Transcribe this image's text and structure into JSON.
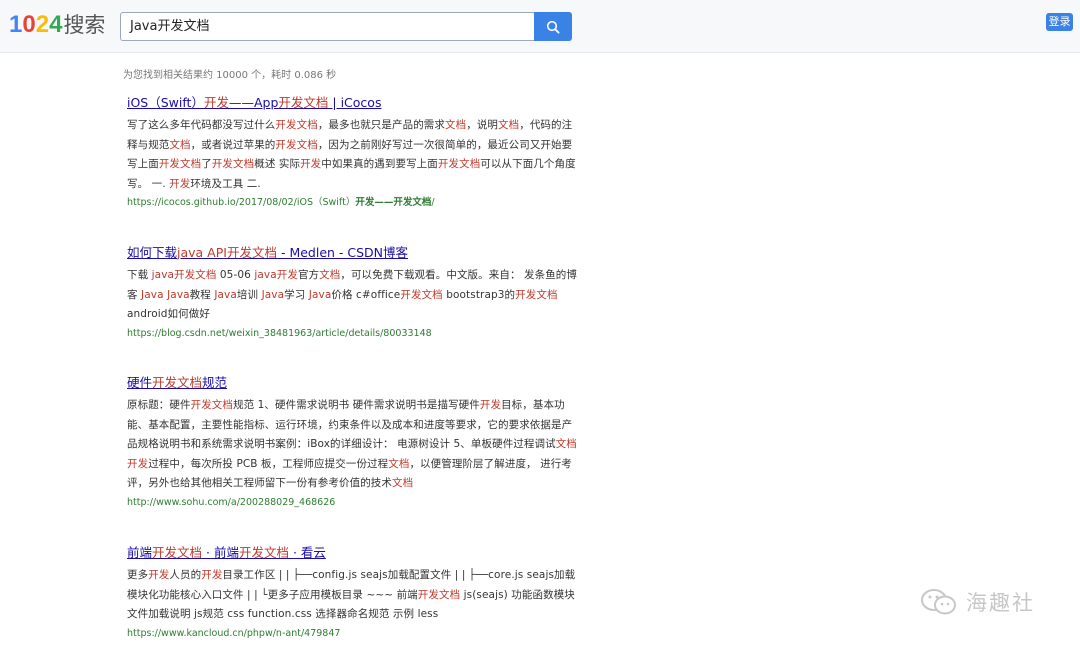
{
  "header": {
    "logo_digits": [
      "1",
      "0",
      "2",
      "4"
    ],
    "logo_text": "搜索",
    "search_value": "Java开发文档",
    "login_label": "登录"
  },
  "stats": "为您找到相关结果约 10000 个，耗时 0.086 秒",
  "results": [
    {
      "title": [
        [
          "iOS（Swift）",
          0
        ],
        [
          "开发",
          1
        ],
        [
          "——App",
          0
        ],
        [
          "开发文档",
          1
        ],
        [
          " | iCocos",
          0
        ]
      ],
      "snippet": [
        [
          "写了这么多年代码都没写过什么",
          0
        ],
        [
          "开发文档",
          1
        ],
        [
          "，最多也就只是产品的需求",
          0
        ],
        [
          "文档",
          1
        ],
        [
          "，说明",
          0
        ],
        [
          "文档",
          1
        ],
        [
          "，代码的注释与规范",
          0
        ],
        [
          "文档",
          1
        ],
        [
          "，或者说过苹果的",
          0
        ],
        [
          "开发文档",
          1
        ],
        [
          "，因为之前刚好写过一次很简单的，最近公司又开始要写上面",
          0
        ],
        [
          "开发文档",
          1
        ],
        [
          "了",
          0
        ],
        [
          "开发文档",
          1
        ],
        [
          "概述 实际",
          0
        ],
        [
          "开发",
          1
        ],
        [
          "中如果真的遇到要写上面",
          0
        ],
        [
          "开发文档",
          1
        ],
        [
          "可以从下面几个角度写。 一. ",
          0
        ],
        [
          "开发",
          1
        ],
        [
          "环境及工具 二.",
          0
        ]
      ],
      "url": [
        [
          "https://icocos.github.io/2017/08/02/iOS（Swift）",
          0
        ],
        [
          "开发——开发文档",
          1
        ],
        [
          "/",
          0
        ]
      ]
    },
    {
      "title": [
        [
          "如何下载",
          0
        ],
        [
          "java API",
          1
        ],
        [
          "开发文档",
          1
        ],
        [
          " - Medlen - CSDN博客",
          0
        ]
      ],
      "snippet": [
        [
          "下载 ",
          0
        ],
        [
          "java开发文档",
          1
        ],
        [
          " 05-06 ",
          0
        ],
        [
          "java开发",
          1
        ],
        [
          "官方",
          0
        ],
        [
          "文档",
          1
        ],
        [
          "，可以免费下载观看。中文版。来自： 发条鱼的博客 ",
          0
        ],
        [
          "Java",
          1
        ],
        [
          " ",
          0
        ],
        [
          "Java",
          1
        ],
        [
          "教程 ",
          0
        ],
        [
          "Java",
          1
        ],
        [
          "培训 ",
          0
        ],
        [
          "Java",
          1
        ],
        [
          "学习 ",
          0
        ],
        [
          "Java",
          1
        ],
        [
          "价格 c#office",
          0
        ],
        [
          "开发文档",
          1
        ],
        [
          " bootstrap3的",
          0
        ],
        [
          "开发文档",
          1
        ],
        [
          " android如何做好",
          0
        ]
      ],
      "url": [
        [
          "https://blog.csdn.net/weixin_38481963/article/details/80033148",
          0
        ]
      ]
    },
    {
      "title": [
        [
          "硬件",
          0
        ],
        [
          "开发文档",
          1
        ],
        [
          "规范",
          0
        ]
      ],
      "snippet": [
        [
          "原标题：硬件",
          0
        ],
        [
          "开发文档",
          1
        ],
        [
          "规范 1、硬件需求说明书 硬件需求说明书是描写硬件",
          0
        ],
        [
          "开发",
          1
        ],
        [
          "目标，基本功能、基本配置，主要性能指标、运行环境，约束条件以及成本和进度等要求，它的要求依据是产品规格说明书和系统需求说明书案例：iBox的详细设计： 电源树设计 5、单板硬件过程调试",
          0
        ],
        [
          "文档",
          1
        ],
        [
          " ",
          0
        ],
        [
          "开发",
          1
        ],
        [
          "过程中，每次所投 PCB 板，工程师应提交一份过程",
          0
        ],
        [
          "文档",
          1
        ],
        [
          "，以便管理阶层了解进度， 进行考评，另外也给其他相关工程师留下一份有参考价值的技术",
          0
        ],
        [
          "文档",
          1
        ]
      ],
      "url": [
        [
          "http://www.sohu.com/a/200288029_468626",
          0
        ]
      ]
    },
    {
      "title": [
        [
          "前端",
          0
        ],
        [
          "开发文档",
          1
        ],
        [
          " · 前端",
          0
        ],
        [
          "开发文档",
          1
        ],
        [
          " · 看云",
          0
        ]
      ],
      "snippet": [
        [
          "更多",
          0
        ],
        [
          "开发",
          1
        ],
        [
          "人员的",
          0
        ],
        [
          "开发",
          1
        ],
        [
          "目录工作区 | | ├──config.js seajs加载配置文件 | | ├──core.js seajs加载模块化功能核心入口文件 | | └更多子应用模板目录 ~~~ 前端",
          0
        ],
        [
          "开发文档",
          1
        ],
        [
          " js(seajs) 功能函数模块 文件加载说明 js规范 css function.css 选择器命名规范 示例 less",
          0
        ]
      ],
      "url": [
        [
          "https://www.kancloud.cn/phpw/n-ant/479847",
          0
        ]
      ]
    }
  ],
  "watermark": "海趣社",
  "icons": {
    "search": "search-icon",
    "watermark": "wechat-icon"
  }
}
